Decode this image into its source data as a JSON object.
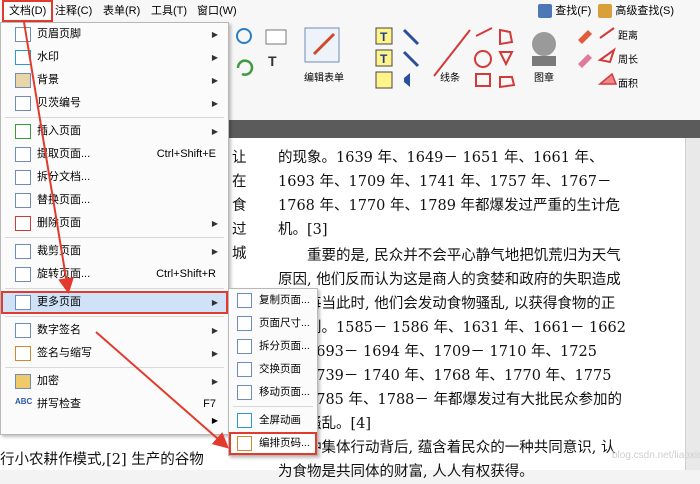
{
  "menubar": {
    "items": [
      "文档(D)",
      "注释(C)",
      "表单(R)",
      "工具(T)",
      "窗口(W)"
    ],
    "search": "查找(F)",
    "advanced_search": "高级查找(S)"
  },
  "ribbon": {
    "edit_form": "编辑表单",
    "lines": "线条",
    "stamp": "图章",
    "distance": "距离",
    "perimeter": "周长",
    "area": "面积"
  },
  "doc_menu": {
    "items": [
      {
        "label": "页眉页脚",
        "arrow": true
      },
      {
        "label": "水印",
        "arrow": true
      },
      {
        "label": "背景",
        "arrow": true
      },
      {
        "label": "贝茨编号",
        "arrow": true
      },
      {
        "label": "插入页面",
        "arrow": true
      },
      {
        "label": "提取页面...",
        "shortcut": "Ctrl+Shift+E"
      },
      {
        "label": "拆分文档..."
      },
      {
        "label": "替换页面..."
      },
      {
        "label": "删除页面",
        "arrow": true
      },
      {
        "label": "裁剪页面",
        "arrow": true
      },
      {
        "label": "旋转页面...",
        "shortcut": "Ctrl+Shift+R"
      },
      {
        "label": "更多页面",
        "arrow": true
      },
      {
        "label": "数字签名",
        "arrow": true
      },
      {
        "label": "签名与缩写",
        "arrow": true
      },
      {
        "label": "加密",
        "arrow": true
      },
      {
        "label": "拼写检查",
        "shortcut": "F7"
      }
    ]
  },
  "submenu": {
    "items": [
      "复制页面...",
      "页面尺寸...",
      "拆分页面...",
      "交换页面",
      "移动页面...",
      "全屏动画",
      "编排页码..."
    ]
  },
  "document": {
    "left_fragments": [
      "让",
      "在",
      "食",
      "过",
      "城"
    ],
    "paragraphs": [
      "的现象。1639 年、1649－ 1651 年、1661 年、1693 年、1709 年、1741 年、1757 年、1767－ 1768 年、1770 年、1789 年都爆发过严重的生计危机。[3]",
      "重要的是, 民众并不会平心静气地把饥荒归为天气原因, 他们反而认为这是商人的贪婪和政府的失职造成的。每当此时, 他们会发动食物骚乱, 以获得食物的正当权利。1585－ 1586 年、1631 年、1661－ 1662 年、1693－ 1694 年、1709－ 1710 年、1725 年、1739－ 1740 年、1768 年、1770 年、1775 年、1785 年、1788－ 年都爆发过有大批民众参加的食物骚乱。[4]",
      "种集体行动背后, 蕴含着民众的一种共同意识, 认为食物是共同体的财富, 人人有权获得。"
    ],
    "bottom_fragment": "行小农耕作模式,[2] 生产的谷物"
  },
  "watermark": "blog.csdn.net/liaoxiao"
}
